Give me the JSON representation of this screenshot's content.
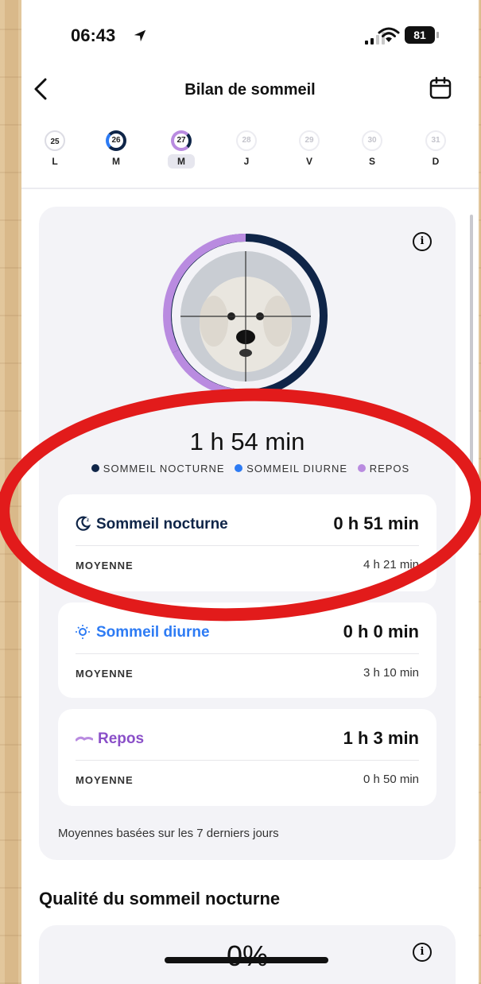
{
  "status_bar": {
    "time": "06:43",
    "battery": "81"
  },
  "header": {
    "title": "Bilan de sommeil"
  },
  "days": [
    {
      "num": "25",
      "letter": "L"
    },
    {
      "num": "26",
      "letter": "M"
    },
    {
      "num": "27",
      "letter": "M"
    },
    {
      "num": "28",
      "letter": "J"
    },
    {
      "num": "29",
      "letter": "V"
    },
    {
      "num": "30",
      "letter": "S"
    },
    {
      "num": "31",
      "letter": "D"
    }
  ],
  "summary": {
    "total": "1 h 54 min",
    "legend": [
      "SOMMEIL NOCTURNE",
      "SOMMEIL DIURNE",
      "REPOS"
    ],
    "colors": {
      "nocturne": "#0f2548",
      "diurne": "#2d7bf4",
      "repos": "#b98be0"
    }
  },
  "sections": [
    {
      "name": "Sommeil nocturne",
      "value": "0 h 51 min",
      "avg_label": "MOYENNE",
      "avg_value": "4 h 21 min"
    },
    {
      "name": "Sommeil diurne",
      "value": "0 h 0 min",
      "avg_label": "MOYENNE",
      "avg_value": "3 h 10 min"
    },
    {
      "name": "Repos",
      "value": "1 h 3 min",
      "avg_label": "MOYENNE",
      "avg_value": "0 h 50 min"
    }
  ],
  "note": "Moyennes basées sur les 7 derniers jours",
  "quality": {
    "title": "Qualité du sommeil nocturne",
    "percent": "0%"
  }
}
